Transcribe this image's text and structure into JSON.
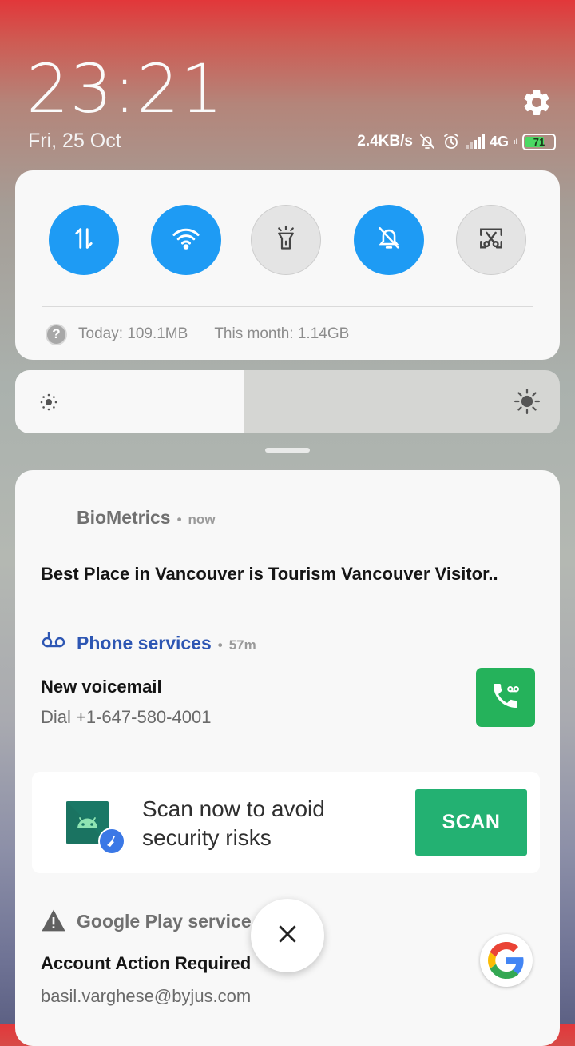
{
  "lockscreen": {
    "time": "23:21",
    "date": "Fri, 25 Oct"
  },
  "status_bar": {
    "net_speed": "2.4KB/s",
    "network": "4G",
    "network_sub": "ıl",
    "battery_level": "71",
    "battery_fraction": 0.71,
    "icons": [
      "bell-off-icon",
      "alarm-icon",
      "signal-icon"
    ]
  },
  "settings_icon": "gear-icon",
  "quick_settings": {
    "toggles": [
      {
        "name": "mobile-data",
        "icon": "data-transfer-icon",
        "state": "on"
      },
      {
        "name": "wifi",
        "icon": "wifi-icon",
        "state": "on"
      },
      {
        "name": "flashlight",
        "icon": "flashlight-icon",
        "state": "off"
      },
      {
        "name": "silent",
        "icon": "bell-off-icon",
        "state": "on"
      },
      {
        "name": "screenshot",
        "icon": "scissors-icon",
        "state": "off"
      }
    ],
    "help_glyph": "?",
    "usage_today": "Today: 109.1MB",
    "usage_month": "This month: 1.14GB"
  },
  "brightness": {
    "level": 0.42
  },
  "notifications": [
    {
      "app": "BioMetrics",
      "dot": "•",
      "time": "now",
      "title": "Best Place in Vancouver is Tourism Vancouver Visitor.."
    },
    {
      "app": "Phone services",
      "dot": "•",
      "time": "57m",
      "title": "New voicemail",
      "text": "Dial +1-647-580-4001",
      "app_color": "#2d56b3"
    },
    {
      "type": "security-card",
      "text": "Scan now to avoid security risks",
      "button": "SCAN",
      "button_color": "#23b172"
    },
    {
      "app": "Google Play service",
      "title": "Account Action Required",
      "text": "basil.varghese@byjus.com"
    }
  ],
  "close_button_glyph": "✕",
  "colors": {
    "accent_blue": "#1e9bf4",
    "panel_bg": "#f8f8f8"
  }
}
